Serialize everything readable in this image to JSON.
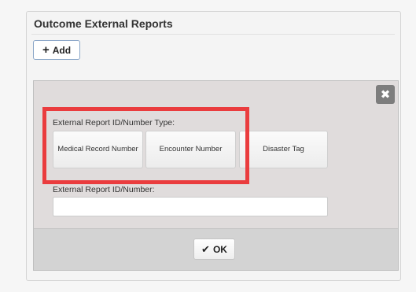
{
  "panel": {
    "title": "Outcome External Reports",
    "add_label": "Add",
    "add_icon": "+"
  },
  "dialog": {
    "close_icon": "✖",
    "type_label": "External Report ID/Number Type:",
    "type_options": [
      {
        "label": "Medical Record Number"
      },
      {
        "label": "Encounter Number"
      },
      {
        "label": "Disaster Tag"
      }
    ],
    "number_label": "External Report ID/Number:",
    "number_value": "",
    "ok_label": "OK",
    "ok_icon": "✔"
  },
  "colors": {
    "highlight": "#ea3c3e",
    "dialog_bg": "#e0dcdc",
    "footer_bg": "#d3d3d3"
  }
}
